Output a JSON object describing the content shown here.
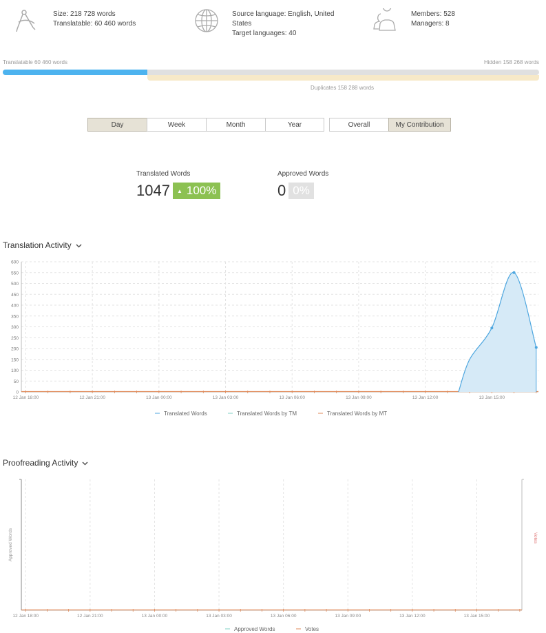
{
  "header": {
    "size": "Size: 218 728 words",
    "translatable": "Translatable: 60 460 words",
    "source_language_line1": "Source language: English, United",
    "source_language_line2": "States",
    "target_languages": "Target languages: 40",
    "members": "Members: 528",
    "managers": "Managers: 8",
    "icons": {
      "size": "compass-icon",
      "language": "globe-icon",
      "members": "users-icon"
    }
  },
  "progress": {
    "translatable_label": "Translatable 60 460 words",
    "hidden_label": "Hidden 158 268 words",
    "duplicates_label": "Duplicates 158 288 words",
    "translatable_fraction": 0.27,
    "colors": {
      "fill": "#4db3ef",
      "track": "#e0e0e0",
      "duplicates": "#f7e9c8"
    }
  },
  "periods": [
    {
      "label": "Day",
      "active": true
    },
    {
      "label": "Week",
      "active": false
    },
    {
      "label": "Month",
      "active": false
    },
    {
      "label": "Year",
      "active": false
    }
  ],
  "scope": [
    {
      "label": "Overall",
      "active": false
    },
    {
      "label": "My Contribution",
      "active": true
    }
  ],
  "kpis": {
    "translated": {
      "label": "Translated Words",
      "value": "1047",
      "badge": "100%",
      "badge_arrow": "▲",
      "color": "#8cc152"
    },
    "approved": {
      "label": "Approved Words",
      "value": "0",
      "badge": "0%",
      "color": "#e1e1e1"
    }
  },
  "translation_activity": {
    "title": "Translation Activity",
    "chevron": "⌄"
  },
  "proofreading_activity": {
    "title": "Proofreading Activity",
    "chevron": "⌄"
  },
  "chart_data": [
    {
      "type": "area",
      "title": "",
      "x_ticks": [
        "12 Jan 18:00",
        "12 Jan 21:00",
        "13 Jan 00:00",
        "13 Jan 03:00",
        "13 Jan 06:00",
        "13 Jan 09:00",
        "13 Jan 12:00",
        "13 Jan 15:00"
      ],
      "x_hours": [
        0,
        3,
        6,
        9,
        12,
        15,
        18,
        21
      ],
      "x_range_hours": [
        -0.2,
        23.1
      ],
      "y_ticks": [
        0,
        50,
        100,
        150,
        200,
        250,
        300,
        350,
        400,
        450,
        500,
        550,
        600
      ],
      "ylim": [
        0,
        600
      ],
      "grid": true,
      "legend_placement": "bottom",
      "series": [
        {
          "name": "Translated Words",
          "color": "#4da6df",
          "fill": "#d6eaf7",
          "points": [
            [
              19.5,
              0
            ],
            [
              20.0,
              150
            ],
            [
              21.0,
              295
            ],
            [
              22.0,
              550
            ],
            [
              23.0,
              205
            ]
          ],
          "markers": [
            [
              21.0,
              295
            ],
            [
              22.0,
              550
            ],
            [
              23.0,
              205
            ]
          ]
        },
        {
          "name": "Translated Words by TM",
          "color": "#7fd1c4",
          "points": []
        },
        {
          "name": "Translated Words by MT",
          "color": "#e08a5a",
          "points": []
        }
      ]
    },
    {
      "type": "line",
      "title": "",
      "ylabel_left": "Approved Words",
      "ylabel_right": "Votes",
      "x_ticks": [
        "12 Jan 18:00",
        "12 Jan 21:00",
        "13 Jan 00:00",
        "13 Jan 03:00",
        "13 Jan 06:00",
        "13 Jan 09:00",
        "13 Jan 12:00",
        "13 Jan 15:00"
      ],
      "x_hours": [
        0,
        3,
        6,
        9,
        12,
        15,
        18,
        21
      ],
      "x_range_hours": [
        -0.2,
        23.1
      ],
      "grid": true,
      "legend_placement": "bottom",
      "series": [
        {
          "name": "Approved Words",
          "color": "#7fd1c4",
          "points": []
        },
        {
          "name": "Votes",
          "color": "#e08a5a",
          "points": []
        }
      ]
    }
  ]
}
